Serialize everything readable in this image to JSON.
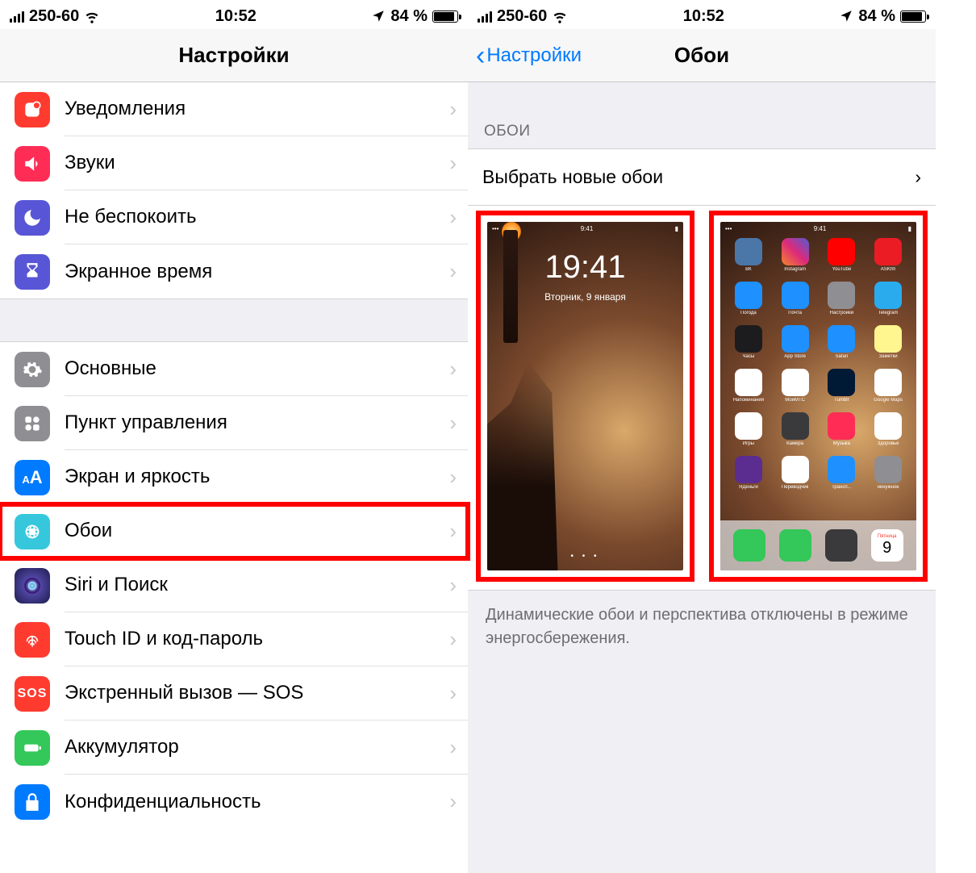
{
  "status": {
    "carrier": "250-60",
    "time": "10:52",
    "battery_pct": "84 %"
  },
  "left": {
    "title": "Настройки",
    "items": [
      {
        "key": "notifications",
        "label": "Уведомления",
        "icon": "ic-notif"
      },
      {
        "key": "sounds",
        "label": "Звуки",
        "icon": "ic-sound"
      },
      {
        "key": "dnd",
        "label": "Не беспокоить",
        "icon": "ic-dnd"
      },
      {
        "key": "screentime",
        "label": "Экранное время",
        "icon": "ic-screentime"
      }
    ],
    "items2": [
      {
        "key": "general",
        "label": "Основные",
        "icon": "ic-general"
      },
      {
        "key": "controlcenter",
        "label": "Пункт управления",
        "icon": "ic-control"
      },
      {
        "key": "display",
        "label": "Экран и яркость",
        "icon": "ic-display"
      },
      {
        "key": "wallpaper",
        "label": "Обои",
        "icon": "ic-wallpaper",
        "highlight": true
      },
      {
        "key": "siri",
        "label": "Siri и Поиск",
        "icon": "ic-siri"
      },
      {
        "key": "touchid",
        "label": "Touch ID и код-пароль",
        "icon": "ic-touchid"
      },
      {
        "key": "sos",
        "label": "Экстренный вызов — SOS",
        "icon": "ic-sos"
      },
      {
        "key": "battery",
        "label": "Аккумулятор",
        "icon": "ic-battery"
      },
      {
        "key": "privacy",
        "label": "Конфиденциальность",
        "icon": "ic-privacy"
      }
    ]
  },
  "right": {
    "back_label": "Настройки",
    "title": "Обои",
    "section": "ОБОИ",
    "choose_label": "Выбрать новые обои",
    "footer": "Динамические обои и перспектива отключены в режиме энергосбережения.",
    "lock_preview": {
      "time": "19:41",
      "date": "Вторник, 9 января"
    },
    "home_preview": {
      "status_time": "9:41",
      "apps": [
        {
          "label": "ВК",
          "color": "#4a76a8"
        },
        {
          "label": "Instagram",
          "color": "linear-gradient(45deg,#f58529,#dd2a7b,#515bd4)"
        },
        {
          "label": "YouTube",
          "color": "#ff0000"
        },
        {
          "label": "ASKfm",
          "color": "#eb1c24"
        },
        {
          "label": "Погода",
          "color": "#1e90ff"
        },
        {
          "label": "Почта",
          "color": "#1e90ff"
        },
        {
          "label": "Настройки",
          "color": "#8e8e93"
        },
        {
          "label": "Telegram",
          "color": "#2aabee"
        },
        {
          "label": "Часы",
          "color": "#1c1c1e"
        },
        {
          "label": "App Store",
          "color": "#1e90ff"
        },
        {
          "label": "Safari",
          "color": "#1e90ff"
        },
        {
          "label": "Заметки",
          "color": "#fff68f"
        },
        {
          "label": "Напоминания",
          "color": "#ffffff"
        },
        {
          "label": "МойМТС",
          "color": "#ffffff"
        },
        {
          "label": "Tumblr",
          "color": "#001935"
        },
        {
          "label": "Google Maps",
          "color": "#ffffff"
        },
        {
          "label": "Игры",
          "color": "#ffffff"
        },
        {
          "label": "Камера",
          "color": "#3a3a3c"
        },
        {
          "label": "Музыка",
          "color": "#ff2d55"
        },
        {
          "label": "Здоровье",
          "color": "#ffffff"
        },
        {
          "label": "ЯДеньги",
          "color": "#5b2d91"
        },
        {
          "label": "Переводчик",
          "color": "#ffffff"
        },
        {
          "label": "Трансп...",
          "color": "#1e90ff"
        },
        {
          "label": "ненужное",
          "color": "#8e8e93"
        }
      ],
      "dock": [
        {
          "name": "phone",
          "color": "#34c759"
        },
        {
          "name": "messages",
          "color": "#34c759"
        },
        {
          "name": "camera",
          "color": "#3a3a3c"
        },
        {
          "name": "calendar",
          "color": "#ffffff",
          "text": "9",
          "sub": "Пятница"
        }
      ]
    }
  }
}
